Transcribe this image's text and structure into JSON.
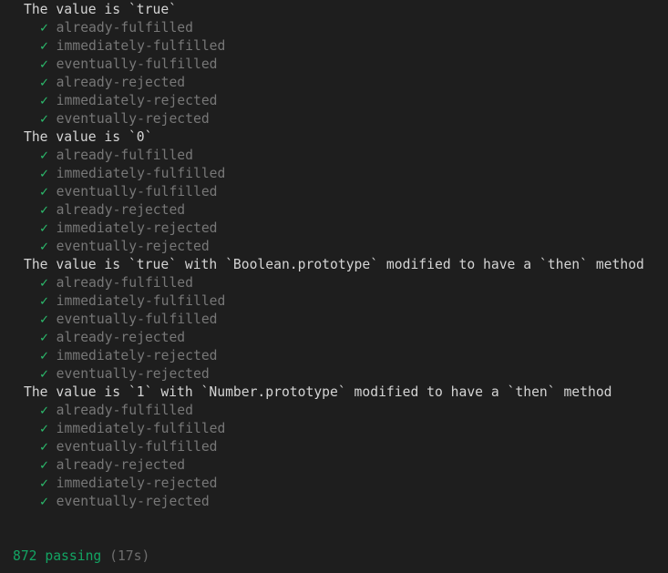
{
  "terminal": {
    "background_color": "#1e1e1e",
    "suite_text_color": "#d4d4d4",
    "test_text_color": "#777777",
    "check_color": "#2cbf6e",
    "pass_color": "#13a463",
    "duration_color": "#6e6e6e",
    "check_glyph": "✓"
  },
  "suites": [
    {
      "title": "The value is `true`",
      "tests": [
        "already-fulfilled",
        "immediately-fulfilled",
        "eventually-fulfilled",
        "already-rejected",
        "immediately-rejected",
        "eventually-rejected"
      ]
    },
    {
      "title": "The value is `0`",
      "tests": [
        "already-fulfilled",
        "immediately-fulfilled",
        "eventually-fulfilled",
        "already-rejected",
        "immediately-rejected",
        "eventually-rejected"
      ]
    },
    {
      "title": "The value is `true` with `Boolean.prototype` modified to have a `then` method",
      "tests": [
        "already-fulfilled",
        "immediately-fulfilled",
        "eventually-fulfilled",
        "already-rejected",
        "immediately-rejected",
        "eventually-rejected"
      ]
    },
    {
      "title": "The value is `1` with `Number.prototype` modified to have a `then` method",
      "tests": [
        "already-fulfilled",
        "immediately-fulfilled",
        "eventually-fulfilled",
        "already-rejected",
        "immediately-rejected",
        "eventually-rejected"
      ]
    }
  ],
  "summary": {
    "passing_text": "872 passing",
    "duration_text": "(17s)"
  }
}
